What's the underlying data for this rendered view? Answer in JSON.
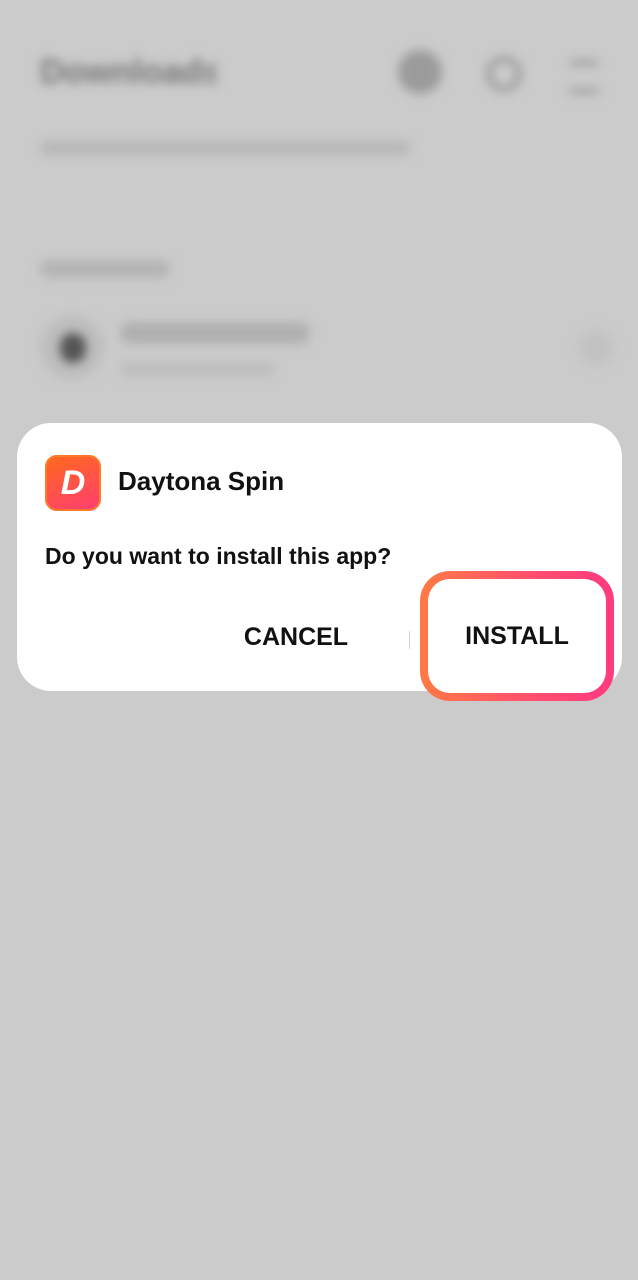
{
  "background": {
    "title": "Downloads",
    "icons": [
      "info-icon",
      "search-icon",
      "menu-icon"
    ]
  },
  "dialog": {
    "app_name": "Daytona Spin",
    "app_icon_letter": "D",
    "question": "Do you want to install this app?",
    "cancel_label": "CANCEL",
    "install_label": "INSTALL"
  },
  "colors": {
    "accent_start": "#ff7a45",
    "accent_end": "#ff3a80",
    "scrim": "#cbcbcb"
  }
}
